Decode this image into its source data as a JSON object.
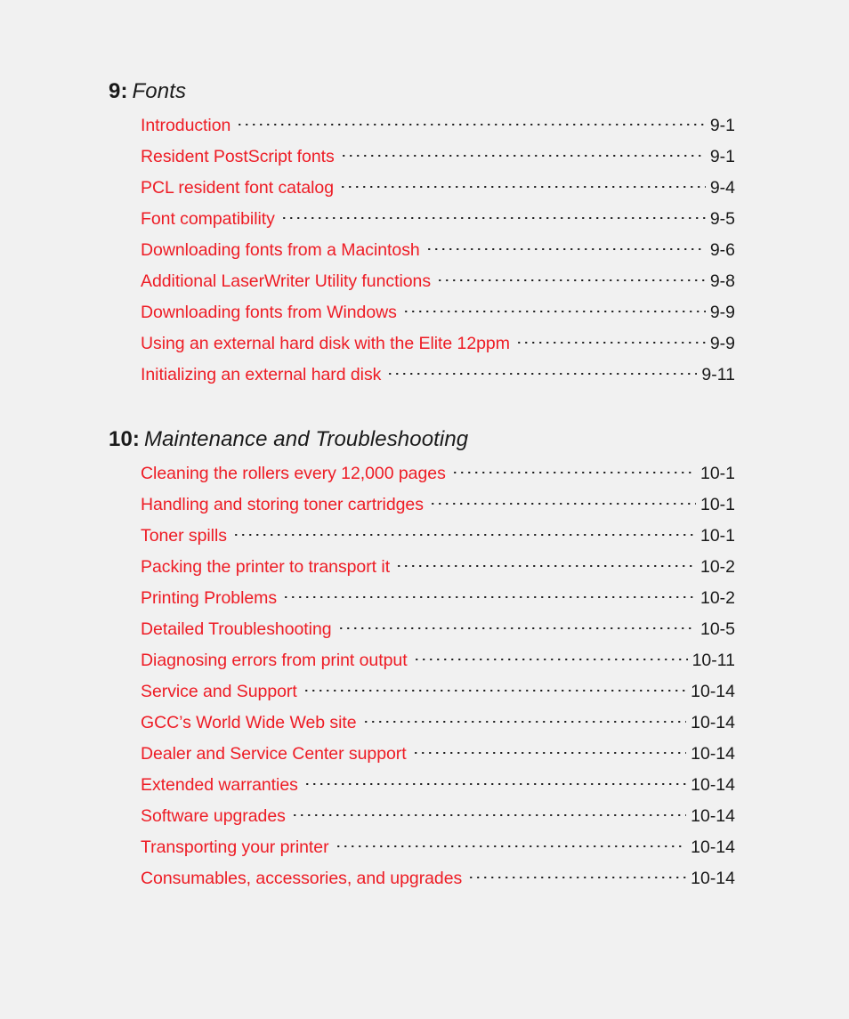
{
  "document": {
    "type": "table-of-contents",
    "background_color": "#f1f1f1",
    "entry_color": "#ee1c25",
    "page_number_color": "#1a1a1a",
    "heading_color": "#1a1a1a"
  },
  "sections": [
    {
      "number": "9:",
      "title": "Fonts",
      "entries": [
        {
          "label": "Introduction",
          "page": "9-1"
        },
        {
          "label": "Resident PostScript fonts",
          "page": "9-1"
        },
        {
          "label": "PCL resident font catalog",
          "page": "9-4"
        },
        {
          "label": "Font compatibility",
          "page": "9-5"
        },
        {
          "label": "Downloading fonts from a Macintosh",
          "page": "9-6"
        },
        {
          "label": "Additional LaserWriter Utility functions",
          "page": "9-8"
        },
        {
          "label": "Downloading fonts from Windows",
          "page": "9-9"
        },
        {
          "label": "Using an external hard disk with the Elite 12ppm",
          "page": "9-9"
        },
        {
          "label": "Initializing an external hard disk",
          "page": "9-11"
        }
      ]
    },
    {
      "number": "10:",
      "title": "Maintenance and Troubleshooting",
      "entries": [
        {
          "label": "Cleaning the rollers every 12,000 pages",
          "page": "10-1"
        },
        {
          "label": "Handling and storing toner cartridges",
          "page": "10-1"
        },
        {
          "label": "Toner spills",
          "page": "10-1"
        },
        {
          "label": "Packing the printer to transport it",
          "page": "10-2"
        },
        {
          "label": "Printing Problems",
          "page": "10-2"
        },
        {
          "label": "Detailed Troubleshooting",
          "page": "10-5"
        },
        {
          "label": "Diagnosing errors from print output",
          "page": "10-11"
        },
        {
          "label": "Service and Support",
          "page": "10-14"
        },
        {
          "label": "GCC’s World Wide Web site",
          "page": "10-14"
        },
        {
          "label": "Dealer and Service Center support",
          "page": "10-14"
        },
        {
          "label": "Extended warranties",
          "page": "10-14"
        },
        {
          "label": "Software upgrades",
          "page": "10-14"
        },
        {
          "label": "Transporting your printer",
          "page": "10-14"
        },
        {
          "label": "Consumables, accessories, and upgrades",
          "page": "10-14"
        }
      ]
    }
  ]
}
